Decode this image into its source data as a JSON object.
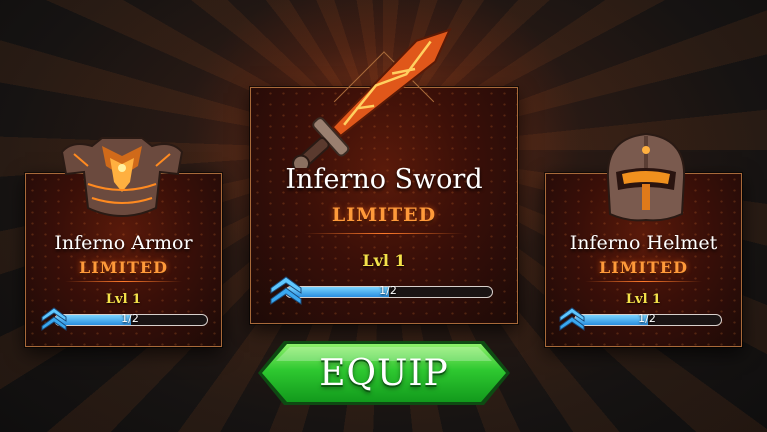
{
  "items": [
    {
      "name": "Inferno Armor",
      "tag": "LIMITED",
      "level": "Lvl 1",
      "progress_text": "1/2",
      "progress": 0.5
    },
    {
      "name": "Inferno Sword",
      "tag": "LIMITED",
      "level": "Lvl 1",
      "progress_text": "1/2",
      "progress": 0.5
    },
    {
      "name": "Inferno Helmet",
      "tag": "LIMITED",
      "level": "Lvl 1",
      "progress_text": "1/2",
      "progress": 0.5
    }
  ],
  "equip_button": {
    "label": "EQUIP"
  },
  "colors": {
    "tag": "#ff9a3a",
    "level": "#f4e24a",
    "progress_fill": "#2a8ee0",
    "equip_green": "#2ec830",
    "card_border": "#a86a3a"
  },
  "icons": [
    "inferno-armor-icon",
    "inferno-sword-icon",
    "inferno-helmet-icon",
    "upgrade-chevron-icon"
  ]
}
